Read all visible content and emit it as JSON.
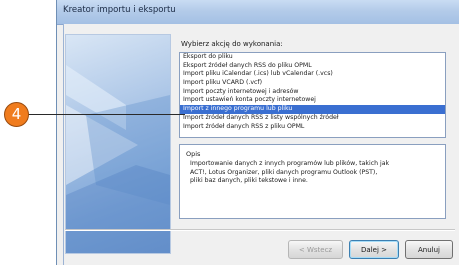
{
  "window": {
    "title": "Kreator importu i eksportu"
  },
  "wizard": {
    "prompt": "Wybierz akcję do wykonania:",
    "actions": [
      {
        "label": "Eksport do pliku",
        "selected": false
      },
      {
        "label": "Eksport źródeł danych RSS do pliku OPML",
        "selected": false
      },
      {
        "label": "Import pliku iCalendar (.ics) lub vCalendar (.vcs)",
        "selected": false
      },
      {
        "label": "Import pliku VCARD (.vcf)",
        "selected": false
      },
      {
        "label": "Import poczty internetowej i adresów",
        "selected": false
      },
      {
        "label": "Import ustawień konta poczty internetowej",
        "selected": false
      },
      {
        "label": "Import z innego programu lub pliku",
        "selected": true
      },
      {
        "label": "Import źródeł danych RSS z listy wspólnych źródeł",
        "selected": false
      },
      {
        "label": "Import źródeł danych RSS z pliku OPML",
        "selected": false
      }
    ],
    "description": {
      "title": "Opis",
      "text": "Importowanie danych z innych programów lub plików, takich jak ACT!, Lotus Organizer, pliki danych programu Outlook (PST), pliki baz danych, pliki tekstowe i inne."
    }
  },
  "buttons": {
    "back": "< Wstecz",
    "next": "Dalej >",
    "cancel": "Anuluj"
  },
  "callout": {
    "number": "4",
    "color": "#f07c1e"
  },
  "colors": {
    "selection": "#3a6fd1",
    "titlebar": "#b3cbe9"
  }
}
